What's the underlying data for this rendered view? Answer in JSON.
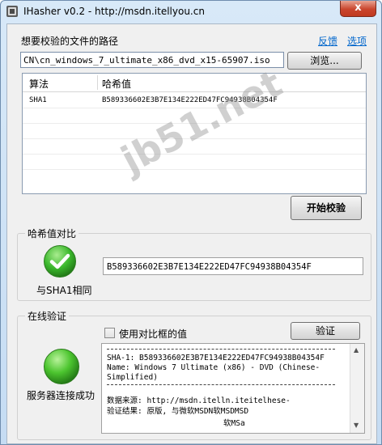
{
  "window": {
    "title": "IHasher v0.2 - http://msdn.itellyou.cn",
    "close_glyph": "x"
  },
  "file": {
    "label": "想要校验的文件的路径",
    "feedback_link": "反馈",
    "options_link": "选项",
    "path_value": "CN\\cn_windows_7_ultimate_x86_dvd_x15-65907.iso",
    "browse_button": "浏览..."
  },
  "table": {
    "columns": [
      "算法",
      "哈希值"
    ],
    "rows": [
      {
        "algorithm": "SHA1",
        "hash": "B589336602E3B7E134E222ED47FC94938B04354F"
      }
    ]
  },
  "actions": {
    "start_button": "开始校验"
  },
  "compare": {
    "group_title": "哈希值对比",
    "status_label": "与SHA1相同",
    "hash_value": "B589336602E3B7E134E222ED47FC94938B04354F",
    "status_color": "#3bb82c"
  },
  "online": {
    "group_title": "在线验证",
    "use_compare_label": "使用对比框的值",
    "use_compare_checked": false,
    "verify_button": "验证",
    "server_status_label": "服务器连接成功",
    "result_lines": [
      "SHA-1: B589336602E3B7E134E222ED47FC94938B04354F",
      "Name: Windows 7 Ultimate (x86) - DVD (Chinese-",
      "Simplified)",
      "数据来源: http://msdn.itelln.iteitelhese-",
      "验证结果: 原版, 与微软MSDN软MSDMSD",
      "软MSa"
    ]
  },
  "watermark": "jb51.net",
  "colors": {
    "link": "#0066cc",
    "close_button": "#c9452d",
    "ok_green": "#3bb82c"
  }
}
